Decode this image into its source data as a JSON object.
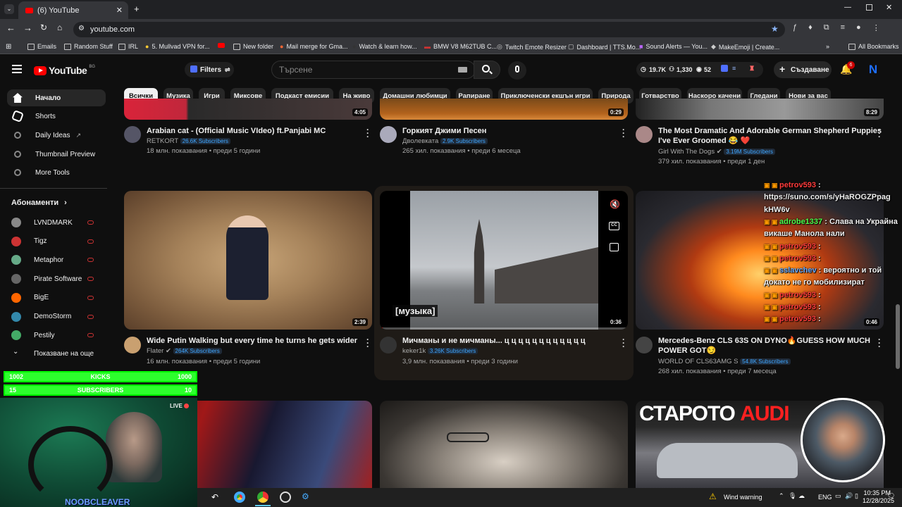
{
  "browser": {
    "tab_title": "(6) YouTube",
    "url": "youtube.com",
    "bookmarks": [
      "Emails",
      "Random Stuff",
      "IRL",
      "5. Mullvad VPN for...",
      "",
      "New folder",
      "Mail merge for Gma...",
      "Watch & learn how...",
      "BMW V8 M62TUB C...",
      "Twitch Emote Resizer",
      "Dashboard | TTS.Mo...",
      "Sound Alerts — You...",
      "MakeEmoji | Create..."
    ],
    "all_bookmarks": "All Bookmarks"
  },
  "header": {
    "logo_text": "YouTube",
    "region": "BG",
    "filters_label": "Filters",
    "search_placeholder": "Търсене",
    "stats": {
      "views": "19.7K",
      "subs": "1,330",
      "watching": "52"
    },
    "create_label": "Създаване",
    "notifications": "6",
    "avatar_letter": "N"
  },
  "chips": [
    "Всички",
    "Музика",
    "Игри",
    "Миксове",
    "Подкаст емисии",
    "На живо",
    "Домашни любимци",
    "Рапиране",
    "Приключенски екшън игри",
    "Природа",
    "Готварство",
    "Наскоро качени",
    "Гледани",
    "Нови за вас"
  ],
  "sidebar": {
    "items": [
      "Начало",
      "Shorts",
      "Daily Ideas",
      "Thumbnail Preview",
      "More Tools"
    ],
    "subs_title": "Абонаменти",
    "subs": [
      "LVNDMARK",
      "Tigz",
      "Metaphor",
      "Pirate Software",
      "BigE",
      "DemoStorm",
      "Pestily"
    ],
    "show_more": "Показване на още"
  },
  "videos_top": [
    {
      "title": "Arabian cat - (Official Music VIdeo) ft.Panjabi MC",
      "channel": "RETKORT",
      "subs": "26.6K Subscribers",
      "meta": "18 млн. показвания • преди 5 години",
      "duration": "4:05"
    },
    {
      "title": "Горкият Джими Песен",
      "channel": "Дволевката",
      "subs": "2.9K Subscribers",
      "meta": "265 хил. показвания • преди 6 месеца",
      "duration": "0:29"
    },
    {
      "title": "The Most Dramatic And Adorable German Shepherd Puppies",
      "title2": "I've Ever Groomed 😂 ❤️",
      "channel": "Girl With The Dogs",
      "subs": "3.19M Subscribers",
      "meta": "379 хил. показвания • преди 1 ден",
      "duration": "8:29"
    }
  ],
  "videos_mid": [
    {
      "title": "Wide Putin Walking but every time he turns he gets wider",
      "channel": "Flater",
      "subs": "264K Subscribers",
      "meta": "16 млн. показвания • преди 5 години",
      "duration": "2:39"
    },
    {
      "title": "Мичманы и не мичманы... ц ц ц ц ц ц ц ц ц ц ц ц",
      "channel": "keker1k",
      "subs": "3.26K Subscribers",
      "meta": "3,9 млн. показвания • преди 3 години",
      "duration": "0:36",
      "caption": "[музыка]"
    },
    {
      "title": "Mercedes-Benz CLS 63S ON DYNO🔥GUESS HOW MUCH",
      "title2": "POWER GOT😏",
      "channel": "WORLD OF CLS63AMG S",
      "subs": "54.8K Subscribers",
      "meta": "268 хил. показвания • преди 7 месеца",
      "duration": "0:46"
    }
  ],
  "bottom_thumb_text": {
    "a": "СТАРОТО ",
    "b": "AUDI"
  },
  "chat": [
    {
      "user": "petrov593",
      "msg": " : "
    },
    {
      "user": "",
      "msg": "https://suno.com/s/yHaROGZPpag"
    },
    {
      "user": "",
      "msg": "kHW6v"
    },
    {
      "user": "adrobe1337",
      "msg": " : Слава на Украйна"
    },
    {
      "user": "",
      "msg": "викаше Манола нали"
    },
    {
      "user": "petrov593",
      "msg": " : "
    },
    {
      "user": "petrov593",
      "msg": " : "
    },
    {
      "user": "sslavchev",
      "msg": " : вероятно и той"
    },
    {
      "user": "",
      "msg": "докато не го мобилизират"
    },
    {
      "user": "petrov593",
      "msg": " : "
    },
    {
      "user": "petrov593",
      "msg": " : "
    },
    {
      "user": "petrov593",
      "msg": " : "
    }
  ],
  "goals": [
    {
      "left": "1002",
      "label": "KICKS",
      "right": "1000",
      "fill": 1.0
    },
    {
      "left": "15",
      "label": "SUBSCRIBERS",
      "right": "10",
      "fill": 1.0
    }
  ],
  "webcam": {
    "live": "LIVE",
    "name": "NOOBCLEAVER"
  },
  "taskbar": {
    "weather": "Wind warning",
    "lang": "ENG",
    "time": "10:35 PM",
    "date": "12/28/2025"
  },
  "colors": {
    "accent": "#ff0000",
    "chip_active": "#f1f1f1",
    "goal_green": "#2dff2d",
    "chat_user": "#ff3b3b",
    "chat_user2": "#4dff4d",
    "chat_user3": "#66aaff"
  }
}
